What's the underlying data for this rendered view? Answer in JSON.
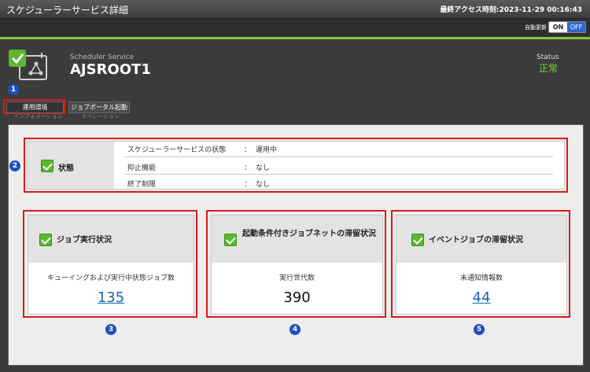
{
  "window": {
    "title": "スケジューラーサービス詳細",
    "last_access": "最終アクセス時刻:2023-11-29 00:16:43"
  },
  "auto_refresh": {
    "label": "自動更新",
    "on": "ON",
    "off": "OFF",
    "state": "OFF"
  },
  "header": {
    "service_type": "Scheduler Service",
    "service_name": "AJSROOT1",
    "status_label": "Status",
    "status_value": "正常"
  },
  "tabs": [
    {
      "label": "運用環境",
      "sub": "インフォメーション"
    },
    {
      "label": "ジョブポータル起動",
      "sub": "オペレーション"
    }
  ],
  "state_panel": {
    "title": "状態",
    "rows": [
      {
        "key": "スケジューラーサービスの状態",
        "sep": "：",
        "value": "運用中"
      },
      {
        "key": "抑止機能",
        "sep": "：",
        "value": "なし"
      },
      {
        "key": "終了制限",
        "sep": "：",
        "value": "なし"
      }
    ]
  },
  "cards": [
    {
      "title": "ジョブ実行状況",
      "subtitle": "キューイングおよび実行中状態ジョブ数",
      "value": "135",
      "link": true
    },
    {
      "title": "起動条件付きジョブネットの滞留状況",
      "subtitle": "実行世代数",
      "value": "390",
      "link": false
    },
    {
      "title": "イベントジョブの滞留状況",
      "subtitle": "未通知情報数",
      "value": "44",
      "link": true
    }
  ],
  "markers": [
    "1",
    "2",
    "3",
    "4",
    "5"
  ],
  "colors": {
    "accent_green": "#8ac23f",
    "status_green": "#7fd33c",
    "marker_blue": "#1d4fbf",
    "highlight_red": "#d91a1a",
    "link_blue": "#1c63b4"
  }
}
